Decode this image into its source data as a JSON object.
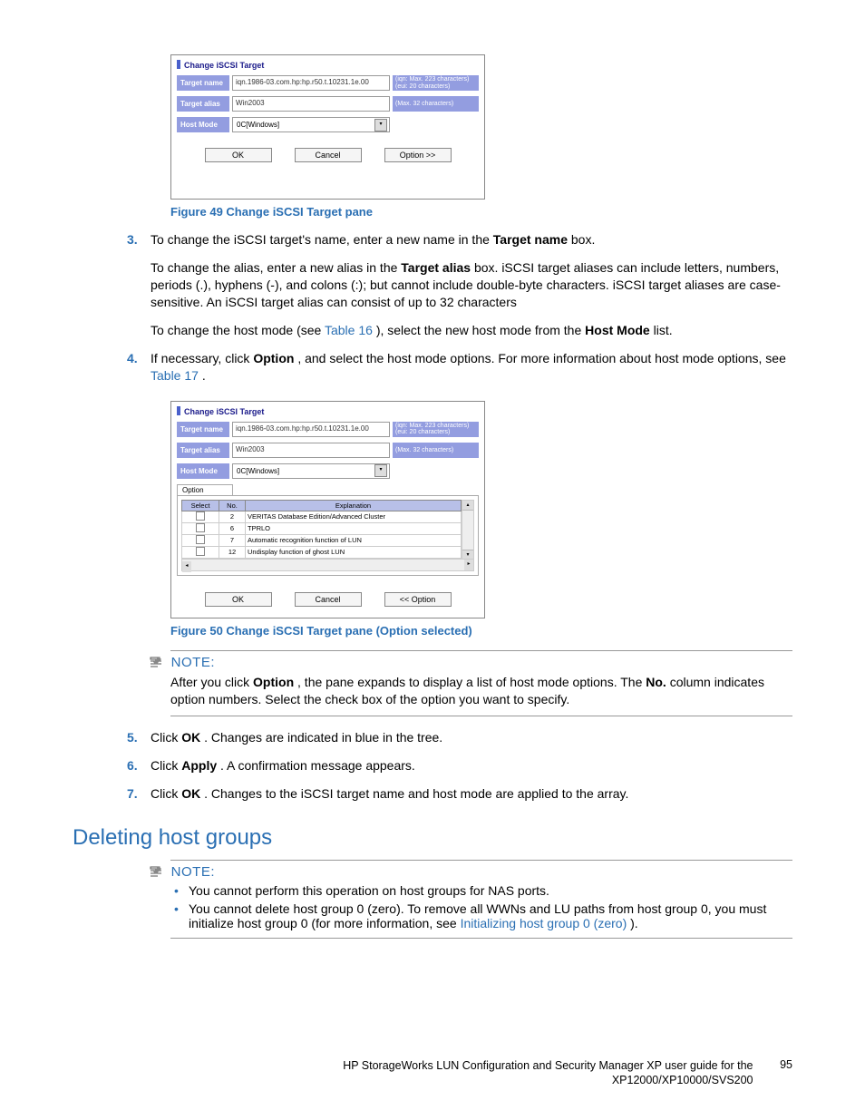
{
  "fig49": {
    "caption": "Figure 49 Change iSCSI Target pane",
    "pane_title": "Change iSCSI Target",
    "rows": {
      "target_name": {
        "label": "Target name",
        "value": "iqn.1986-03.com.hp:hp.r50.t.10231.1e.00",
        "hint1": "(iqn: Max. 223 characters)",
        "hint2": "(eui: 20 characters)"
      },
      "target_alias": {
        "label": "Target alias",
        "value": "Win2003",
        "hint": "(Max. 32 characters)"
      },
      "host_mode": {
        "label": "Host Mode",
        "value": "0C[Windows]"
      }
    },
    "buttons": {
      "ok": "OK",
      "cancel": "Cancel",
      "option": "Option >>"
    }
  },
  "step3": {
    "num": "3.",
    "p1a": "To change the iSCSI target's name, enter a new name in the ",
    "p1b": "Target name",
    "p1c": " box.",
    "p2a": "To change the alias, enter a new alias in the ",
    "p2b": "Target alias",
    "p2c": " box. iSCSI target aliases can include letters, numbers, periods (.), hyphens (-), and colons (:); but cannot include double-byte characters. iSCSI target aliases are case-sensitive. An iSCSI target alias can consist of up to 32 characters",
    "p3a": "To change the host mode (see ",
    "p3link": "Table 16",
    "p3b": "), select the new host mode from the ",
    "p3c": "Host Mode",
    "p3d": " list."
  },
  "step4": {
    "num": "4.",
    "a": "If necessary, click ",
    "b": "Option",
    "c": ", and select the host mode options. For more information about host mode options, see ",
    "link": "Table 17",
    "d": "."
  },
  "fig50": {
    "caption": "Figure 50 Change iSCSI Target pane (Option selected)",
    "pane_title": "Change iSCSI Target",
    "rows": {
      "target_name": {
        "label": "Target name",
        "value": "iqn.1986-03.com.hp:hp.r50.t.10231.1e.00",
        "hint1": "(iqn: Max. 223 characters)",
        "hint2": "(eui: 20 characters)"
      },
      "target_alias": {
        "label": "Target alias",
        "value": "Win2003",
        "hint": "(Max. 32 characters)"
      },
      "host_mode": {
        "label": "Host Mode",
        "value": "0C[Windows]"
      }
    },
    "option_label": "Option",
    "option_headers": {
      "select": "Select",
      "no": "No.",
      "exp": "Explanation"
    },
    "option_rows": [
      {
        "no": "2",
        "exp": "VERITAS Database Edition/Advanced Cluster"
      },
      {
        "no": "6",
        "exp": "TPRLO"
      },
      {
        "no": "7",
        "exp": "Automatic recognition function of LUN"
      },
      {
        "no": "12",
        "exp": "Undisplay function of ghost LUN"
      }
    ],
    "buttons": {
      "ok": "OK",
      "cancel": "Cancel",
      "option": "<< Option"
    }
  },
  "note1": {
    "head": "NOTE:",
    "a": "After you click ",
    "b": "Option",
    "c": ", the pane expands to display a list of host mode options. The ",
    "d": "No.",
    "e": " column indicates option numbers. Select the check box of the option you want to specify."
  },
  "step5": {
    "num": "5.",
    "a": "Click ",
    "b": "OK",
    "c": ". Changes are indicated in blue in the tree."
  },
  "step6": {
    "num": "6.",
    "a": "Click ",
    "b": "Apply",
    "c": ". A confirmation message appears."
  },
  "step7": {
    "num": "7.",
    "a": "Click ",
    "b": "OK",
    "c": ". Changes to the iSCSI target name and host mode are applied to the array."
  },
  "section2": "Deleting host groups",
  "note2": {
    "head": "NOTE:",
    "li1": "You cannot perform this operation on host groups for NAS ports.",
    "li2a": "You cannot delete host group 0 (zero). To remove all WWNs and LU paths from host group 0, you must initialize host group 0 (for more information, see ",
    "li2link": "Initializing host group 0 (zero)",
    "li2b": ")."
  },
  "footer": {
    "line1": "HP StorageWorks LUN Configuration and Security Manager XP user guide for the",
    "line2": "XP12000/XP10000/SVS200",
    "page": "95"
  }
}
